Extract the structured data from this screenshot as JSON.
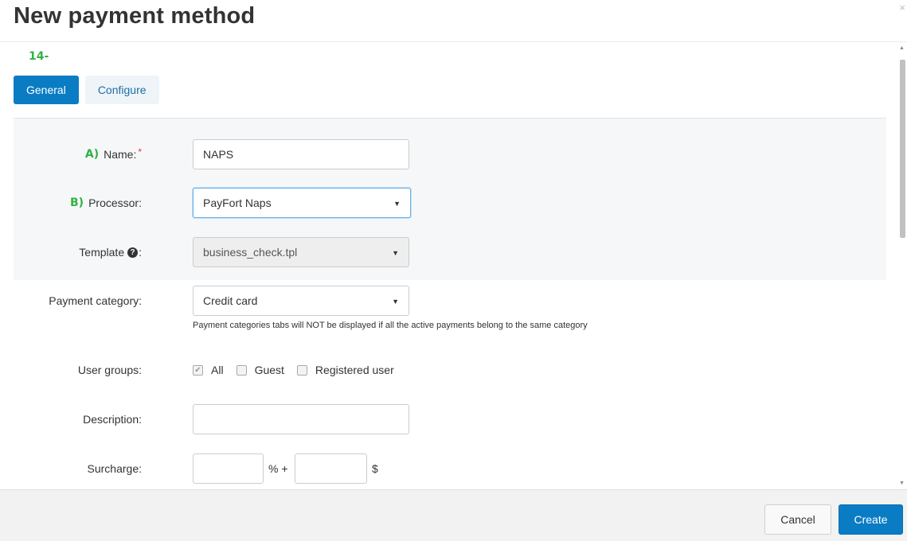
{
  "dialog": {
    "title": "New payment method",
    "close_glyph": "×"
  },
  "annotations": {
    "step": "14-",
    "name": "A)",
    "processor": "B)"
  },
  "tabs": [
    {
      "label": "General",
      "active": true
    },
    {
      "label": "Configure",
      "active": false
    }
  ],
  "form": {
    "name": {
      "label": "Name:",
      "required_mark": "*",
      "value": "NAPS"
    },
    "processor": {
      "label": "Processor:",
      "value": "PayFort Naps"
    },
    "template": {
      "label": "Template",
      "label_suffix": ":",
      "help_glyph": "?",
      "value": "business_check.tpl"
    },
    "payment_category": {
      "label": "Payment category:",
      "value": "Credit card",
      "hint": "Payment categories tabs will NOT be displayed if all the active payments belong to the same category"
    },
    "user_groups": {
      "label": "User groups:",
      "options": [
        {
          "label": "All",
          "checked": true,
          "disabled": true
        },
        {
          "label": "Guest",
          "checked": false,
          "disabled": false
        },
        {
          "label": "Registered user",
          "checked": false,
          "disabled": false
        }
      ]
    },
    "description": {
      "label": "Description:",
      "value": ""
    },
    "surcharge": {
      "label": "Surcharge:",
      "percent_unit": "% +",
      "currency_unit": "$",
      "percent_value": "",
      "amount_value": ""
    }
  },
  "footer": {
    "cancel_label": "Cancel",
    "create_label": "Create"
  },
  "icons": {
    "select_caret": "▼",
    "check_mark": "✔",
    "scroll_up": "▲",
    "scroll_down": "▼"
  },
  "colors": {
    "primary": "#0a7cc4",
    "annotation": "#2fb344",
    "required": "#e23b3b"
  }
}
